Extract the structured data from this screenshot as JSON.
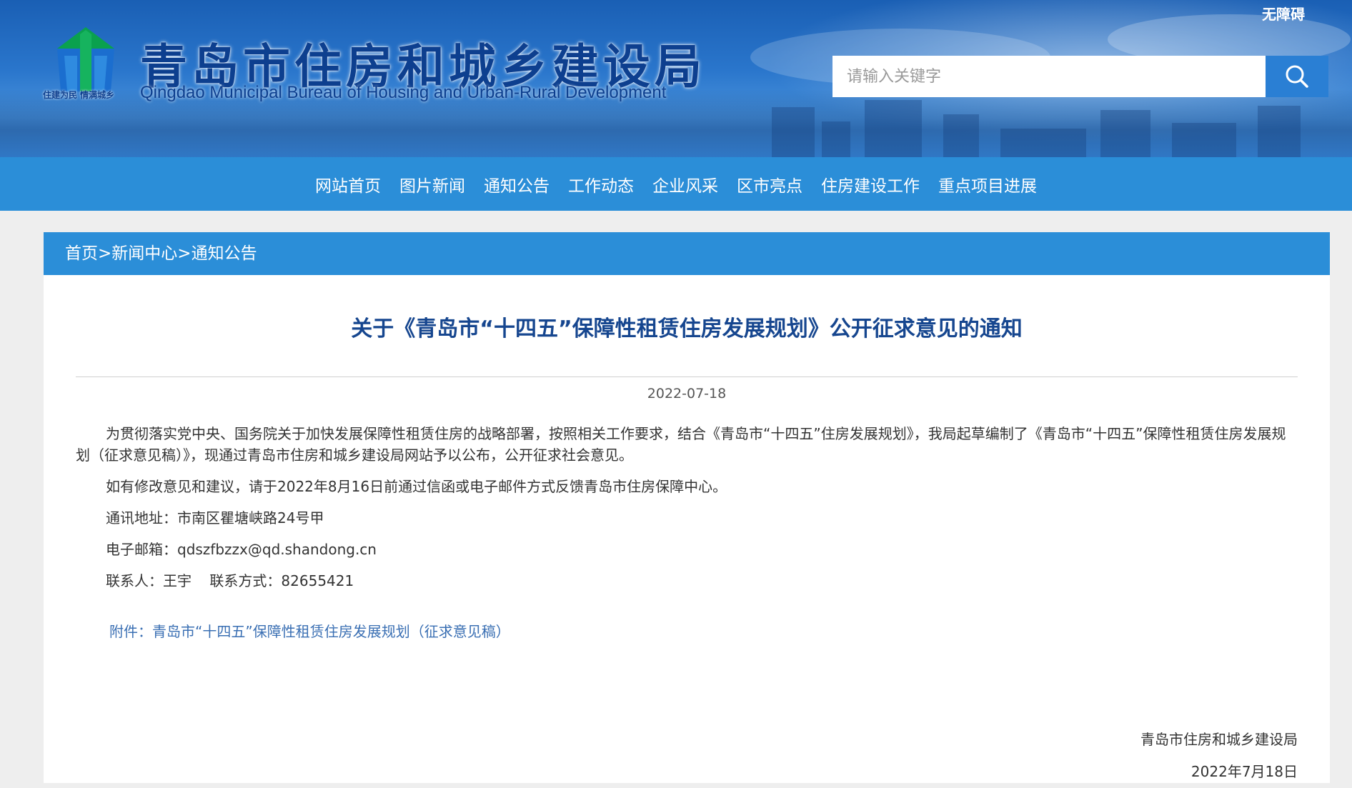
{
  "header": {
    "site_title": "青岛市住房和城乡建设局",
    "site_subtitle": "Qingdao Municipal Bureau of Housing and Urban-Rural Development",
    "slogan": "住建为民 情满城乡",
    "accessibility_label": "无障碍",
    "search_placeholder": "请输入关键字",
    "colors": {
      "primary": "#2b8ed8",
      "title": "#0d3f8f"
    }
  },
  "nav": {
    "items": [
      "网站首页",
      "图片新闻",
      "通知公告",
      "工作动态",
      "企业风采",
      "区市亮点",
      "住房建设工作",
      "重点项目进展"
    ]
  },
  "breadcrumb": {
    "home": "首页",
    "news_center": "新闻中心",
    "current": "通知公告",
    "separator": ">"
  },
  "article": {
    "title": "关于《青岛市“十四五”保障性租赁住房发展规划》公开征求意见的通知",
    "date": "2022-07-18",
    "paragraphs": [
      "为贯彻落实党中央、国务院关于加快发展保障性租赁住房的战略部署，按照相关工作要求，结合《青岛市“十四五”住房发展规划》，我局起草编制了《青岛市“十四五”保障性租赁住房发展规划（征求意见稿）》，现通过青岛市住房和城乡建设局网站予以公布，公开征求社会意见。",
      "如有修改意见和建议，请于2022年8月16日前通过信函或电子邮件方式反馈青岛市住房保障中心。",
      "通讯地址：市南区瞿塘峡路24号甲",
      "电子邮箱：qdszfbzzx@qd.shandong.cn",
      "联系人：王宇    联系方式：82655421"
    ],
    "attachment": "附件：青岛市“十四五”保障性租赁住房发展规划（征求意见稿）",
    "signature_org": "青岛市住房和城乡建设局",
    "signature_date": "2022年7月18日"
  }
}
